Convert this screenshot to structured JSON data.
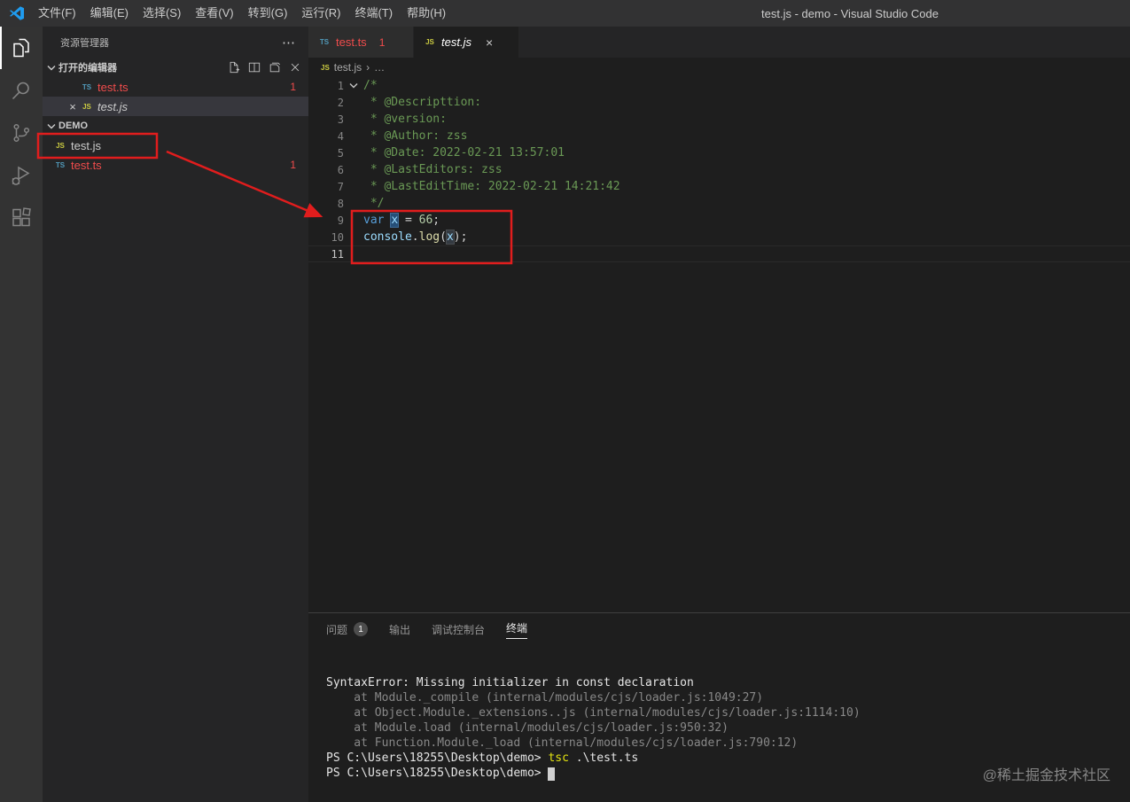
{
  "title_bar": {
    "title": "test.js - demo - Visual Studio Code",
    "menus": [
      {
        "id": "file",
        "label": "文件(F)"
      },
      {
        "id": "edit",
        "label": "编辑(E)"
      },
      {
        "id": "selection",
        "label": "选择(S)"
      },
      {
        "id": "view",
        "label": "查看(V)"
      },
      {
        "id": "go",
        "label": "转到(G)"
      },
      {
        "id": "run",
        "label": "运行(R)"
      },
      {
        "id": "terminal",
        "label": "终端(T)"
      },
      {
        "id": "help",
        "label": "帮助(H)"
      }
    ]
  },
  "activity_bar": {
    "items": [
      {
        "name": "explorer",
        "active": true
      },
      {
        "name": "search",
        "active": false
      },
      {
        "name": "source-control",
        "active": false
      },
      {
        "name": "run-debug",
        "active": false
      },
      {
        "name": "extensions",
        "active": false
      }
    ]
  },
  "sidebar": {
    "title": "资源管理器",
    "more_label": "⋯",
    "open_editors": {
      "label": "打开的编辑器",
      "items": [
        {
          "icon": "TS",
          "name": "test.ts",
          "badge": "1",
          "error": true,
          "active": false,
          "preview": false
        },
        {
          "icon": "JS",
          "name": "test.js",
          "active": true,
          "preview": true,
          "error": false
        }
      ]
    },
    "folder": {
      "label": "DEMO",
      "items": [
        {
          "icon": "JS",
          "name": "test.js",
          "error": false
        },
        {
          "icon": "TS",
          "name": "test.ts",
          "badge": "1",
          "error": true
        }
      ]
    }
  },
  "editor": {
    "tabs": [
      {
        "icon": "TS",
        "name": "test.ts",
        "badge": "1",
        "error": true,
        "active": false,
        "preview": false
      },
      {
        "icon": "JS",
        "name": "test.js",
        "active": true,
        "preview": true,
        "error": false
      }
    ],
    "breadcrumb": {
      "icon": "JS",
      "file": "test.js",
      "separator": "›",
      "more": "…"
    },
    "code": {
      "lines": [
        {
          "num": "1",
          "fold": true,
          "tokens": [
            {
              "t": "/*",
              "c": "comment"
            }
          ]
        },
        {
          "num": "2",
          "tokens": [
            {
              "t": " * @Descripttion: ",
              "c": "comment"
            }
          ]
        },
        {
          "num": "3",
          "tokens": [
            {
              "t": " * @version: ",
              "c": "comment"
            }
          ]
        },
        {
          "num": "4",
          "tokens": [
            {
              "t": " * @Author: zss",
              "c": "comment"
            }
          ]
        },
        {
          "num": "5",
          "tokens": [
            {
              "t": " * @Date: 2022-02-21 13:57:01",
              "c": "comment"
            }
          ]
        },
        {
          "num": "6",
          "tokens": [
            {
              "t": " * @LastEditors: zss",
              "c": "comment"
            }
          ]
        },
        {
          "num": "7",
          "tokens": [
            {
              "t": " * @LastEditTime: 2022-02-21 14:21:42",
              "c": "comment"
            }
          ]
        },
        {
          "num": "8",
          "tokens": [
            {
              "t": " */",
              "c": "comment"
            }
          ]
        },
        {
          "num": "9",
          "tokens": [
            {
              "t": "var",
              "c": "keyword"
            },
            {
              "t": " ",
              "c": "plain"
            },
            {
              "t": "x",
              "c": "var-selected"
            },
            {
              "t": " = ",
              "c": "plain"
            },
            {
              "t": "66",
              "c": "number"
            },
            {
              "t": ";",
              "c": "plain"
            }
          ]
        },
        {
          "num": "10",
          "tokens": [
            {
              "t": "console",
              "c": "variable"
            },
            {
              "t": ".",
              "c": "plain"
            },
            {
              "t": "log",
              "c": "function"
            },
            {
              "t": "(",
              "c": "plain"
            },
            {
              "t": "x",
              "c": "var-occurrence"
            },
            {
              "t": ");",
              "c": "plain"
            }
          ]
        },
        {
          "num": "11",
          "active": true,
          "tokens": []
        }
      ]
    }
  },
  "panel": {
    "tabs": [
      {
        "id": "problems",
        "label": "问题",
        "badge": "1",
        "active": false
      },
      {
        "id": "output",
        "label": "输出",
        "active": false
      },
      {
        "id": "debug-console",
        "label": "调试控制台",
        "active": false
      },
      {
        "id": "terminal",
        "label": "终端",
        "active": true
      }
    ],
    "terminal": {
      "lines": [
        {
          "tokens": [
            {
              "t": "SyntaxError: Missing initializer in const declaration",
              "c": "bright"
            }
          ]
        },
        {
          "tokens": [
            {
              "t": "    at Module._compile (internal/modules/cjs/loader.js:1049:27)",
              "c": "dim"
            }
          ]
        },
        {
          "tokens": [
            {
              "t": "    at Object.Module._extensions..js (internal/modules/cjs/loader.js:1114:10)",
              "c": "dim"
            }
          ]
        },
        {
          "tokens": [
            {
              "t": "    at Module.load (internal/modules/cjs/loader.js:950:32)",
              "c": "dim"
            }
          ]
        },
        {
          "tokens": [
            {
              "t": "    at Function.Module._load (internal/modules/cjs/loader.js:790:12)",
              "c": "dim"
            }
          ]
        },
        {
          "tokens": [
            {
              "t": "PS C:\\Users\\18255\\Desktop\\demo> ",
              "c": "bright"
            },
            {
              "t": "tsc",
              "c": "yellow"
            },
            {
              "t": " .\\test.ts",
              "c": "bright"
            }
          ]
        },
        {
          "tokens": [
            {
              "t": "PS C:\\Users\\18255\\Desktop\\demo> ",
              "c": "bright"
            },
            {
              "t": " ",
              "c": "cursor"
            }
          ]
        }
      ]
    }
  },
  "watermark": "@稀土掘金技术社区",
  "colors": {
    "annotation_red": "#e11d1d",
    "error_red": "#f14c4c",
    "comment_green": "#6a9955",
    "keyword_blue": "#569cd6",
    "variable_blue": "#9cdcfe",
    "function_yellow": "#dcdcaa",
    "number_green": "#b5cea8"
  }
}
